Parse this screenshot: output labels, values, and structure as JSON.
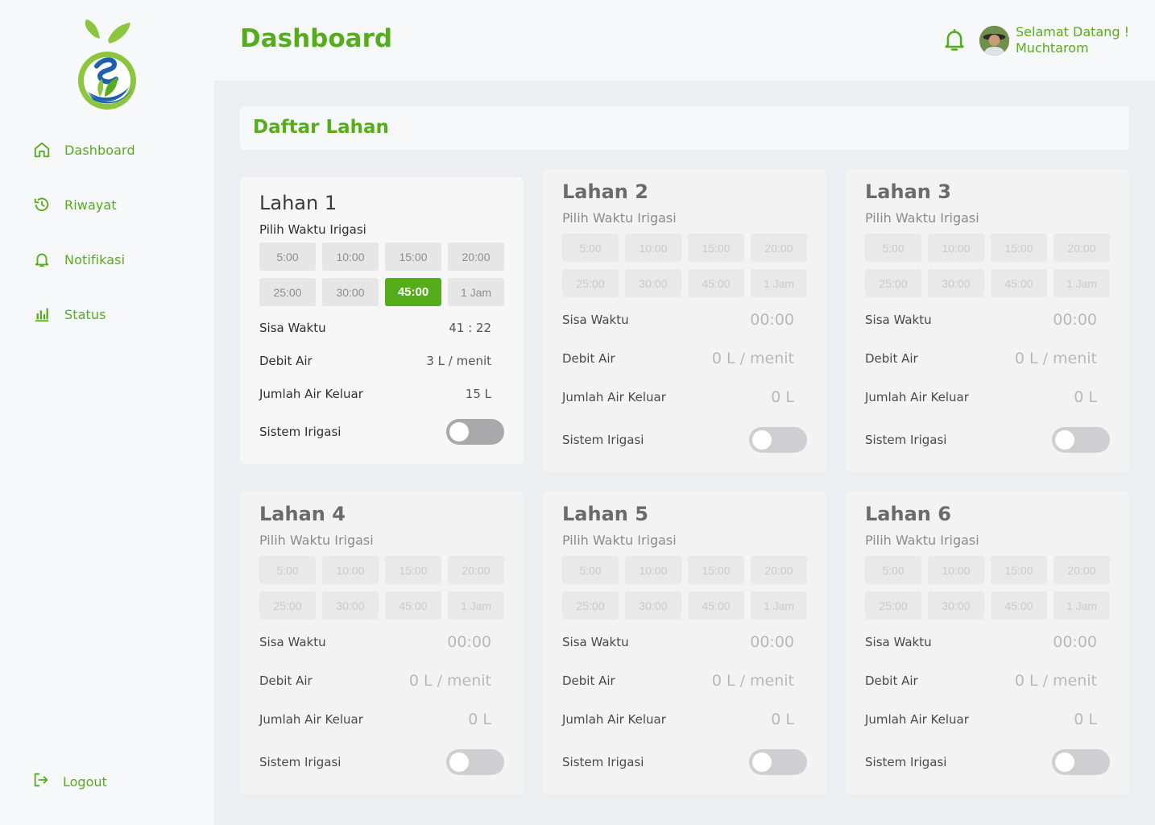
{
  "colors": {
    "brand": "#56ad1b",
    "brand_blue": "#1f5fb0",
    "muted": "#cbcbcb"
  },
  "sidebar": {
    "items": [
      {
        "label": "Dashboard",
        "icon": "home-icon"
      },
      {
        "label": "Riwayat",
        "icon": "history-icon"
      },
      {
        "label": "Notifikasi",
        "icon": "bell-icon"
      },
      {
        "label": "Status",
        "icon": "bar-chart-icon"
      }
    ],
    "logout_label": "Logout"
  },
  "header": {
    "title": "Dashboard",
    "welcome_line1": "Selamat Datang !",
    "welcome_line2": "Muchtarom"
  },
  "section": {
    "title": "Daftar Lahan"
  },
  "labels": {
    "pick_time": "Pilih Waktu Irigasi",
    "remaining": "Sisa Waktu",
    "flow": "Debit Air",
    "total": "Jumlah Air Keluar",
    "system": "Sistem Irigasi"
  },
  "time_options": [
    "5:00",
    "10:00",
    "15:00",
    "20:00",
    "25:00",
    "30:00",
    "45:00",
    "1 Jam"
  ],
  "cards": [
    {
      "title": "Lahan 1",
      "selected": "45:00",
      "remaining": "41 : 22",
      "flow": "3 L / menit",
      "total": "15 L",
      "on": false
    },
    {
      "title": "Lahan 2",
      "selected": "",
      "remaining": "00:00",
      "flow": "0 L / menit",
      "total": "0 L",
      "on": false
    },
    {
      "title": "Lahan 3",
      "selected": "",
      "remaining": "00:00",
      "flow": "0 L / menit",
      "total": "0 L",
      "on": false
    },
    {
      "title": "Lahan 4",
      "selected": "",
      "remaining": "00:00",
      "flow": "0 L / menit",
      "total": "0 L",
      "on": false
    },
    {
      "title": "Lahan 5",
      "selected": "",
      "remaining": "00:00",
      "flow": "0 L / menit",
      "total": "0 L",
      "on": false
    },
    {
      "title": "Lahan 6",
      "selected": "",
      "remaining": "00:00",
      "flow": "0 L / menit",
      "total": "0 L",
      "on": false
    }
  ]
}
